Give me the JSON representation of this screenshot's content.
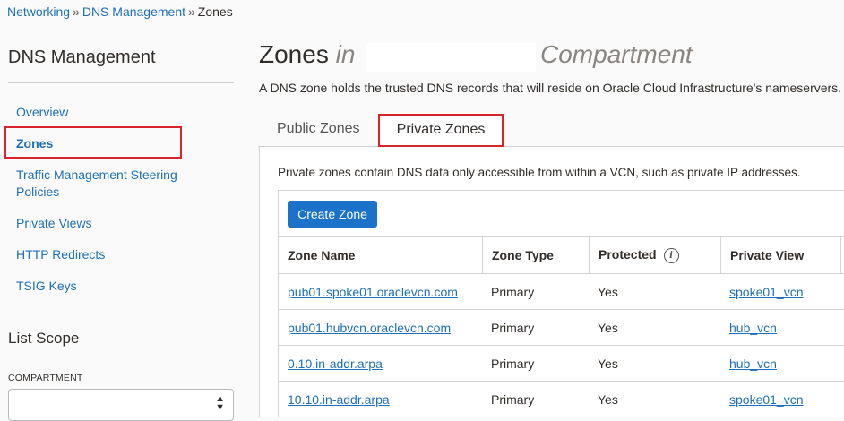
{
  "breadcrumb": {
    "items": [
      "Networking",
      "DNS Management"
    ],
    "separator": "»",
    "current": "Zones"
  },
  "sidebar": {
    "title": "DNS Management",
    "nav": [
      {
        "label": "Overview"
      },
      {
        "label": "Zones",
        "active": true
      },
      {
        "label": "Traffic Management Steering Policies"
      },
      {
        "label": "Private Views"
      },
      {
        "label": "HTTP Redirects"
      },
      {
        "label": "TSIG Keys"
      }
    ],
    "list_scope_title": "List Scope",
    "compartment_label": "COMPARTMENT",
    "compartment_value": ""
  },
  "main": {
    "title": "Zones",
    "title_in": "in",
    "title_compartment": "Compartment",
    "description": "A DNS zone holds the trusted DNS records that will reside on Oracle Cloud Infrastructure's nameservers.",
    "tabs": [
      {
        "label": "Public Zones",
        "active": false
      },
      {
        "label": "Private Zones",
        "active": true
      }
    ],
    "panel_description": "Private zones contain DNS data only accessible from within a VCN, such as private IP addresses.",
    "create_button": "Create Zone",
    "table": {
      "columns": [
        "Zone Name",
        "Zone Type",
        "Protected",
        "Private View"
      ],
      "rows": [
        {
          "name": "pub01.spoke01.oraclevcn.com",
          "type": "Primary",
          "protected": "Yes",
          "view": "spoke01_vcn"
        },
        {
          "name": "pub01.hubvcn.oraclevcn.com",
          "type": "Primary",
          "protected": "Yes",
          "view": "hub_vcn"
        },
        {
          "name": "0.10.in-addr.arpa",
          "type": "Primary",
          "protected": "Yes",
          "view": "hub_vcn"
        },
        {
          "name": "10.10.in-addr.arpa",
          "type": "Primary",
          "protected": "Yes",
          "view": "spoke01_vcn"
        }
      ]
    }
  },
  "colors": {
    "link": "#1f6fb7",
    "primary_button": "#1a73c8",
    "highlight_box": "#d9242b"
  }
}
